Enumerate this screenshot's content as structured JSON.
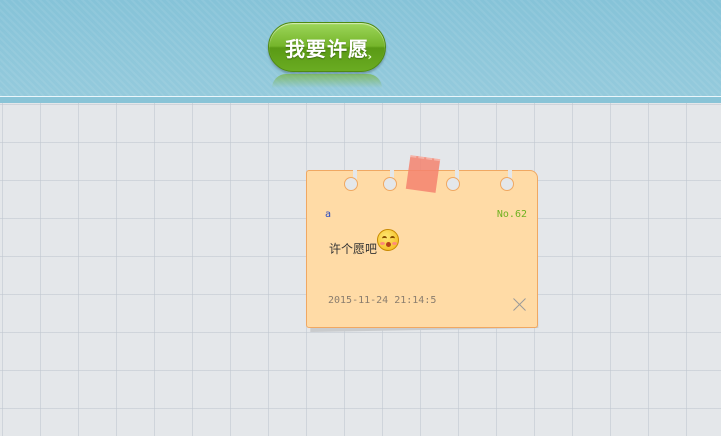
{
  "header": {
    "wish_button_label": "我要许愿"
  },
  "note": {
    "author": "a",
    "number": "No.62",
    "content": "许个愿吧",
    "emoji_icon": "blushing-face-icon",
    "timestamp": "2015-11-24 21:14:5",
    "close_icon": "close-icon",
    "colors": {
      "paper": "#ffdba6",
      "border": "#f0a862",
      "tape": "#f5826e",
      "number_text": "#6fb220",
      "author_text": "#2a4bc0"
    }
  }
}
